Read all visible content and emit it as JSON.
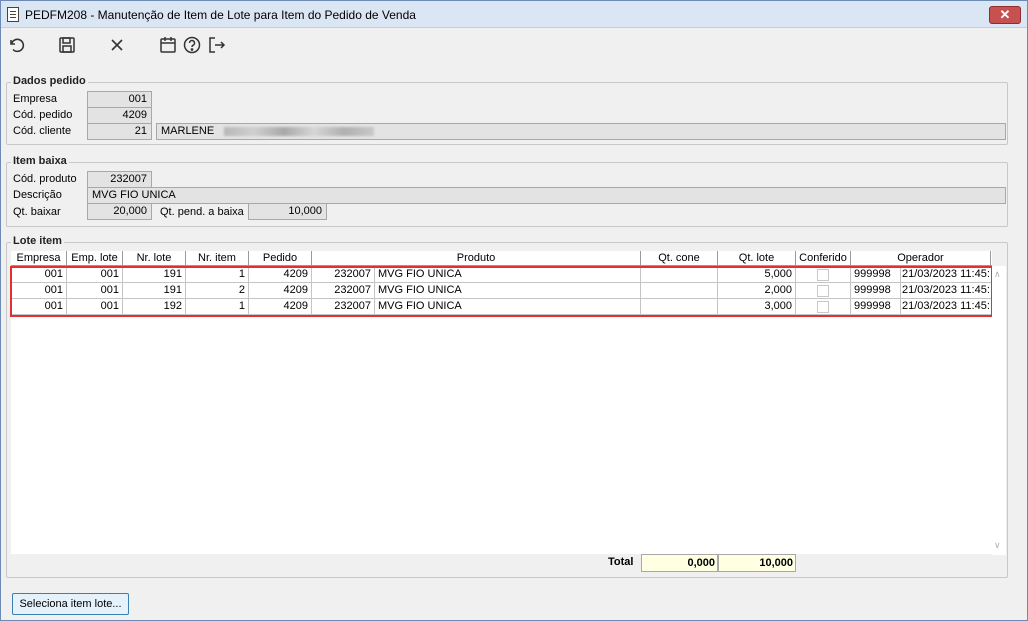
{
  "window": {
    "title": "PEDFM208 - Manutenção de Item de Lote para Item do Pedido de Venda",
    "close_label": "✕"
  },
  "toolbar": {
    "icons": [
      "undo-icon",
      "save-icon",
      "close-icon",
      "calendar-icon",
      "help-icon",
      "exit-icon"
    ]
  },
  "dados_pedido": {
    "title": "Dados pedido",
    "empresa_label": "Empresa",
    "empresa_value": "001",
    "cod_pedido_label": "Cód. pedido",
    "cod_pedido_value": "4209",
    "cod_cliente_label": "Cód. cliente",
    "cod_cliente_value": "21",
    "cliente_nome": "MARLENE"
  },
  "item_baixa": {
    "title": "Item baixa",
    "cod_produto_label": "Cód. produto",
    "cod_produto_value": "232007",
    "descricao_label": "Descrição",
    "descricao_value": "MVG FIO UNICA",
    "qt_baixar_label": "Qt. baixar",
    "qt_baixar_value": "20,000",
    "qt_pend_label": "Qt. pend. a baixa",
    "qt_pend_value": "10,000"
  },
  "lote_item": {
    "title": "Lote item",
    "columns": [
      "Empresa",
      "Emp. lote",
      "Nr. lote",
      "Nr. item",
      "Pedido",
      "Produto",
      "Qt. cone",
      "Qt. lote",
      "Conferido",
      "Operador"
    ],
    "rows": [
      {
        "empresa": "001",
        "emp_lote": "001",
        "nr_lote": "191",
        "nr_item": "1",
        "pedido": "4209",
        "produto_cod": "232007",
        "produto_desc": "MVG FIO UNICA",
        "qt_cone": "",
        "qt_lote": "5,000",
        "conferido": false,
        "operador_cod": "999998",
        "operador_data": "21/03/2023 11:45:"
      },
      {
        "empresa": "001",
        "emp_lote": "001",
        "nr_lote": "191",
        "nr_item": "2",
        "pedido": "4209",
        "produto_cod": "232007",
        "produto_desc": "MVG FIO UNICA",
        "qt_cone": "",
        "qt_lote": "2,000",
        "conferido": false,
        "operador_cod": "999998",
        "operador_data": "21/03/2023 11:45:"
      },
      {
        "empresa": "001",
        "emp_lote": "001",
        "nr_lote": "192",
        "nr_item": "1",
        "pedido": "4209",
        "produto_cod": "232007",
        "produto_desc": "MVG FIO UNICA",
        "qt_cone": "",
        "qt_lote": "3,000",
        "conferido": false,
        "operador_cod": "999998",
        "operador_data": "21/03/2023 11:45:"
      }
    ],
    "total_label": "Total",
    "total_qt_cone": "0,000",
    "total_qt_lote": "10,000"
  },
  "actions": {
    "seleciona_label": "Seleciona item lote..."
  }
}
